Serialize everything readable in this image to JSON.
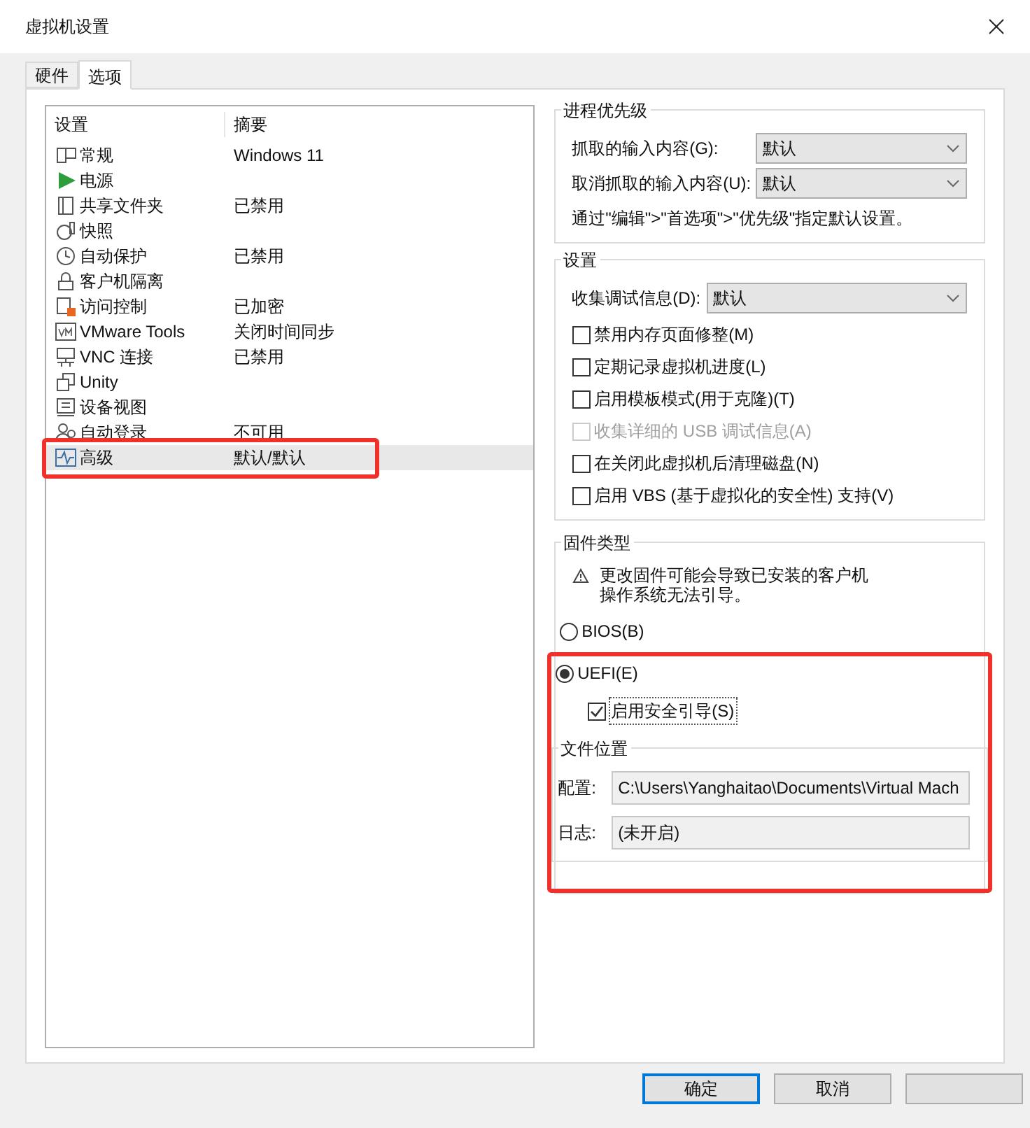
{
  "window": {
    "title": "虚拟机设置"
  },
  "tabs": [
    {
      "label": "硬件",
      "selected": false
    },
    {
      "label": "选项",
      "selected": true
    }
  ],
  "settings_list": {
    "columns": [
      "设置",
      "摘要"
    ],
    "rows": [
      {
        "kind": "monitor",
        "name": "常规",
        "summary": "Windows 11",
        "selected": false,
        "annotated": false
      },
      {
        "kind": "play",
        "name": "电源",
        "selected": false,
        "annotated": false
      },
      {
        "kind": "folder",
        "name": "共享文件夹",
        "summary": "已禁用",
        "selected": false,
        "annotated": false
      },
      {
        "kind": "snapshot",
        "name": "快照",
        "selected": false,
        "annotated": false
      },
      {
        "kind": "clock",
        "name": "自动保护",
        "summary": "已禁用",
        "selected": false,
        "annotated": false
      },
      {
        "kind": "lock",
        "name": "客户机隔离",
        "selected": false,
        "annotated": false
      },
      {
        "kind": "access",
        "name": "访问控制",
        "summary": "已加密",
        "selected": false,
        "annotated": false
      },
      {
        "kind": "vm",
        "name": "VMware Tools",
        "summary": "关闭时间同步",
        "selected": false,
        "annotated": false
      },
      {
        "kind": "network",
        "name": "VNC 连接",
        "summary": "已禁用",
        "selected": false,
        "annotated": false
      },
      {
        "kind": "windows",
        "name": "Unity",
        "selected": false,
        "annotated": false
      },
      {
        "kind": "device",
        "name": "设备视图",
        "selected": false,
        "annotated": false
      },
      {
        "kind": "user",
        "name": "自动登录",
        "summary": "不可用",
        "selected": false,
        "annotated": false
      },
      {
        "kind": "pulse",
        "name": "高级",
        "summary": "默认/默认",
        "selected": true,
        "annotated": true
      }
    ]
  },
  "process_priority": {
    "title": "进程优先级",
    "fields": [
      {
        "label": "抓取的输入内容(G):",
        "value": "默认"
      },
      {
        "label": "取消抓取的输入内容(U):",
        "value": "默认"
      }
    ],
    "note": "通过\"编辑\">\"首选项\">\"优先级\"指定默认设置。"
  },
  "settings": {
    "title": "设置",
    "debug": {
      "label": "收集调试信息(D):",
      "value": "默认"
    },
    "options": [
      {
        "label": "禁用内存页面修整(M)",
        "checked": false,
        "disabled": false
      },
      {
        "label": "定期记录虚拟机进度(L)",
        "checked": false,
        "disabled": false
      },
      {
        "label": "启用模板模式(用于克隆)(T)",
        "checked": false,
        "disabled": false
      },
      {
        "label": "收集详细的 USB 调试信息(A)",
        "checked": false,
        "disabled": true
      },
      {
        "label": "在关闭此虚拟机后清理磁盘(N)",
        "checked": false,
        "disabled": false
      },
      {
        "label": "启用 VBS (基于虚拟化的安全性) 支持(V)",
        "checked": false,
        "disabled": false
      }
    ]
  },
  "firmware": {
    "title": "固件类型",
    "warning": [
      "更改固件可能会导致已安装的客户机",
      "操作系统无法引导。"
    ],
    "types": [
      {
        "label": "BIOS(B)",
        "selected": false
      },
      {
        "label": "UEFI(E)",
        "selected": true
      }
    ],
    "secure_boot": {
      "label": "启用安全引导(S)",
      "checked": true
    },
    "annotated": true
  },
  "file_location": {
    "title": "文件位置",
    "fields": [
      {
        "label": "配置:",
        "value": "C:\\Users\\Yanghaitao\\Documents\\Virtual Mach"
      },
      {
        "label": "日志:",
        "value": "(未开启)"
      }
    ]
  },
  "buttons": [
    {
      "label": "确定",
      "default": true
    },
    {
      "label": "取消",
      "default": false
    },
    {
      "default": false
    }
  ]
}
